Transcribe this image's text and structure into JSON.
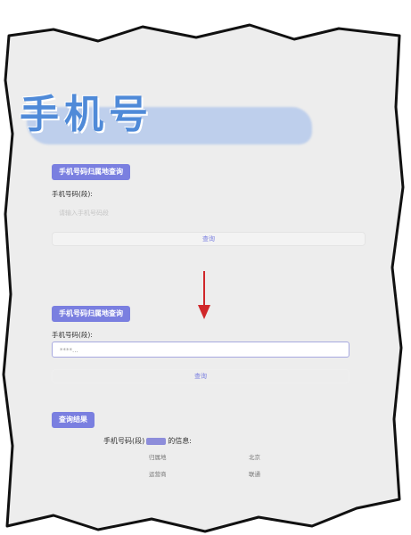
{
  "header": {
    "title": "手机号"
  },
  "section1": {
    "badge": "手机号码归属地查询",
    "field_label": "手机号码(段):",
    "input_placeholder": "请输入手机号码段",
    "query_button": "查询"
  },
  "section2": {
    "badge": "手机号码归属地查询",
    "field_label": "手机号码(段):",
    "input_value": "****...",
    "query_button": "查询"
  },
  "result": {
    "badge": "查询结果",
    "info_prefix": "手机号码(段)",
    "info_suffix": "的信息:",
    "rows": [
      {
        "key": "归属地",
        "value": "北京"
      },
      {
        "key": "运营商",
        "value": "联通"
      }
    ]
  },
  "colors": {
    "accent": "#7a7fe0",
    "arrow": "#d0272a",
    "title": "#4f8ad8"
  }
}
